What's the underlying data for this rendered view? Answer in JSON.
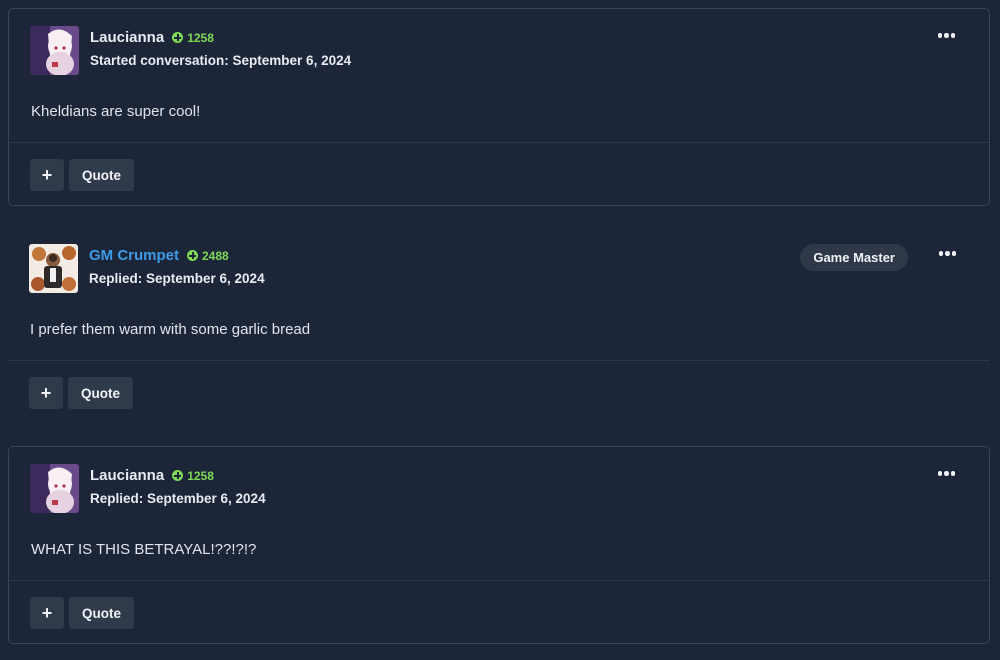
{
  "posts": [
    {
      "author": "Laucianna",
      "reputation": "1258",
      "meta": "Started conversation: September 6, 2024",
      "content": "Kheldians are super cool!",
      "role_badge": "",
      "plus_label": "+",
      "quote_label": "Quote"
    },
    {
      "author": "GM Crumpet",
      "reputation": "2488",
      "meta": "Replied: September 6, 2024",
      "content": "I prefer them warm with some garlic bread",
      "role_badge": "Game Master",
      "plus_label": "+",
      "quote_label": "Quote"
    },
    {
      "author": "Laucianna",
      "reputation": "1258",
      "meta": "Replied: September 6, 2024",
      "content": "WHAT IS THIS BETRAYAL!??!?!?",
      "role_badge": "",
      "plus_label": "+",
      "quote_label": "Quote"
    }
  ],
  "colors": {
    "background": "#1b2538",
    "staff_name": "#3d9be9",
    "reputation": "#7ed957",
    "button_bg": "#2f3a4b"
  }
}
